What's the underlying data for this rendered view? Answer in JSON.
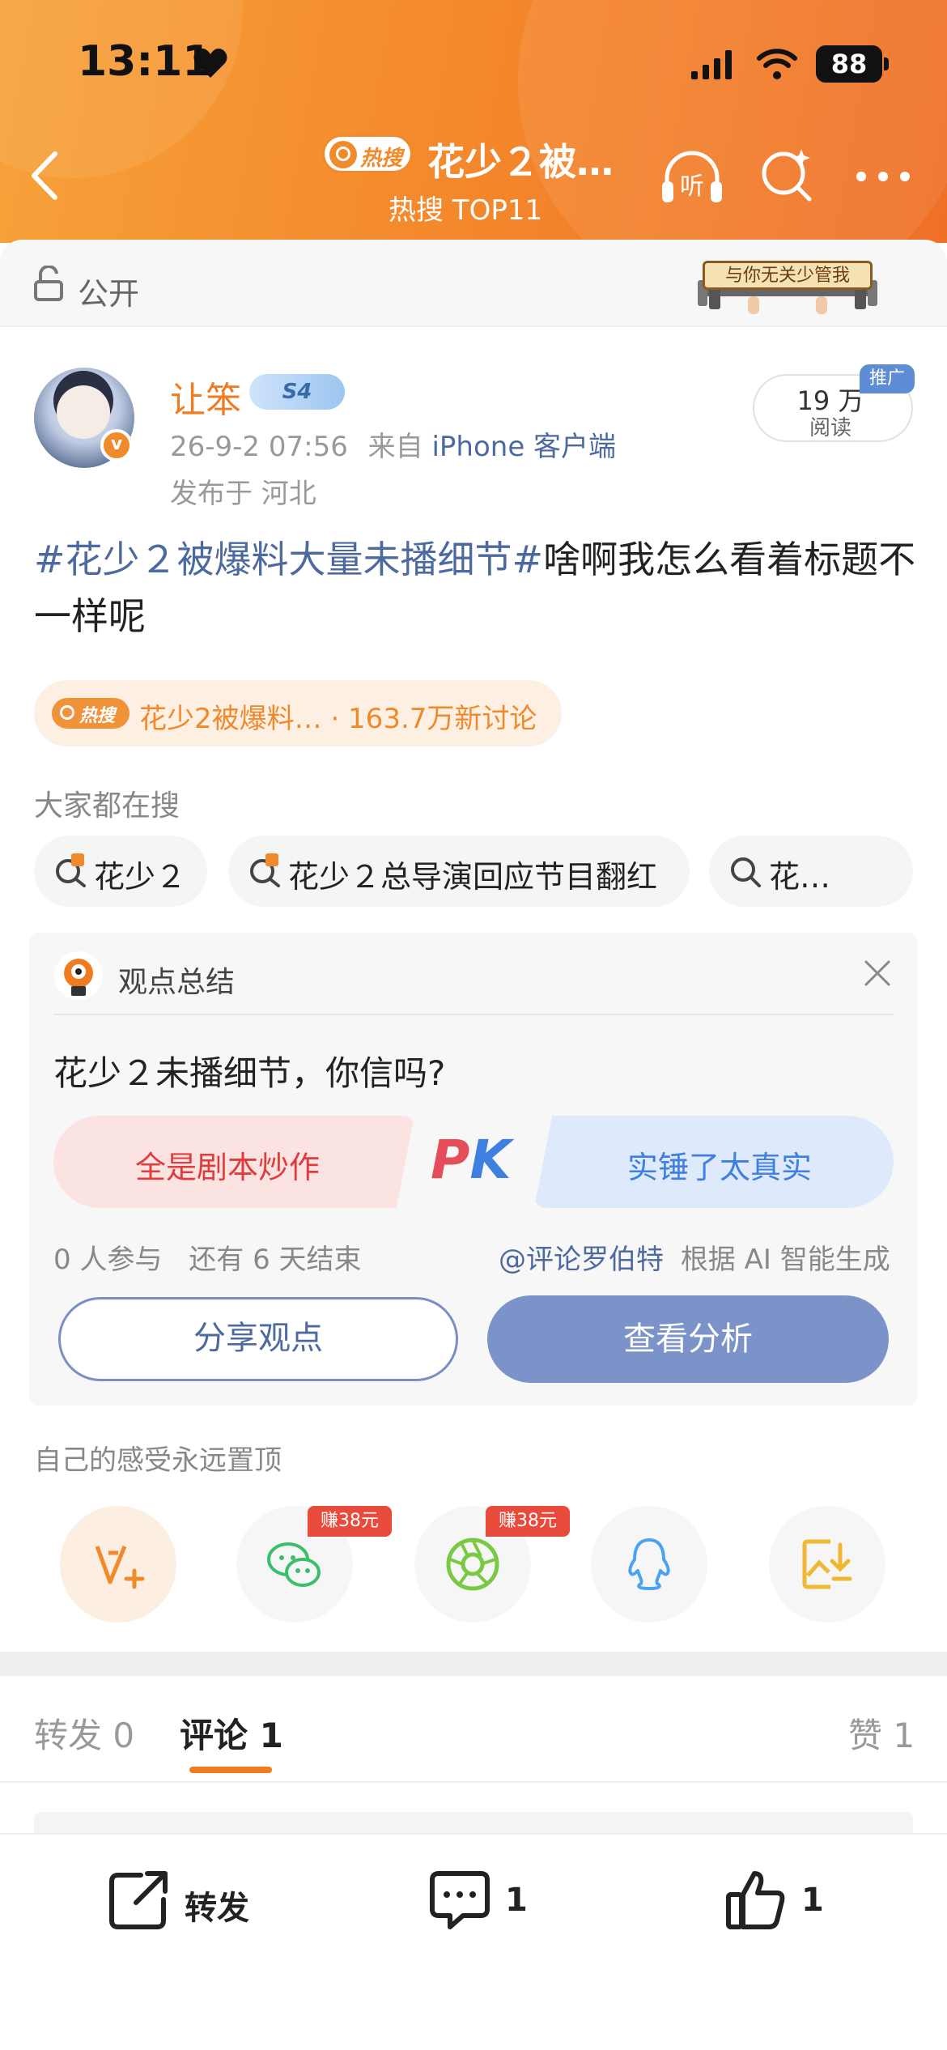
{
  "status_bar": {
    "time": "13:11",
    "battery": "88"
  },
  "header": {
    "hot_badge": "热搜",
    "title": "花少２被…",
    "subtitle": "热搜 TOP11",
    "listen_label": "听"
  },
  "visibility": {
    "label": "公开",
    "sticker_text": "与你无关少管我"
  },
  "post": {
    "username": "让笨",
    "level_badge": "S4",
    "meta_time": "26-9-2 07:56",
    "meta_from": "来自",
    "meta_source": "iPhone 客户端",
    "location": "发布于 河北",
    "reads_value": "19 万",
    "reads_label": "阅读",
    "promo_label": "推广",
    "hashtag": "#花少２被爆料大量未播细节#",
    "body": "啥啊我怎么看着标题不一样呢"
  },
  "hot_pill": {
    "badge": "热搜",
    "text": "花少2被爆料… · 163.7万新讨论"
  },
  "search_section": {
    "label": "大家都在搜",
    "chips": [
      "花少２",
      "花少２总导演回应节目翻红",
      "花…"
    ]
  },
  "opinion": {
    "title": "观点总结",
    "question": "花少２未播细节，你信吗?",
    "option_a": "全是剧本炒作",
    "option_b": "实锤了太真实",
    "pk_p": "P",
    "pk_k": "K",
    "participants": "0 人参与",
    "remaining": "还有 6 天结束",
    "mention": "@评论罗伯特",
    "ai_note": "根据 AI 智能生成",
    "share_btn": "分享观点",
    "analyze_btn": "查看分析"
  },
  "share_section": {
    "label": "自己的感受永远置顶",
    "earn_1": "赚38元",
    "earn_2": "赚38元",
    "icons": [
      "weibo-v-plus-icon",
      "wechat-icon",
      "moments-icon",
      "qq-icon",
      "save-image-icon"
    ]
  },
  "tabs": {
    "repost": "转发 0",
    "comment": "评论 1",
    "like": "赞 1"
  },
  "bottom_bar": {
    "repost_label": "转发",
    "comment_count": "1",
    "like_count": "1"
  },
  "colors": {
    "accent_orange": "#f07c22",
    "link_blue": "#4c6aa0",
    "header_start": "#f7a23a",
    "header_end": "#ef6f26"
  }
}
